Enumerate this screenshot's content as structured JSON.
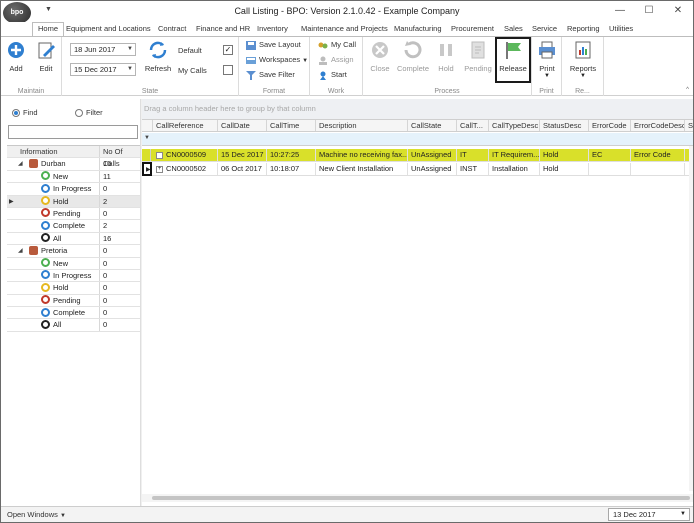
{
  "window": {
    "logo": "bpo",
    "title": "Call Listing - BPO: Version 2.1.0.42 - Example Company",
    "minimize": "—",
    "maximize": "☐",
    "close": "✕"
  },
  "tabs": [
    "Home",
    "Equipment and Locations",
    "Contract",
    "Finance and HR",
    "Inventory",
    "Maintenance and Projects",
    "Manufacturing",
    "Procurement",
    "Sales",
    "Service",
    "Reporting",
    "Utilities"
  ],
  "ribbon": {
    "maintain": {
      "label": "Maintain",
      "add": "Add",
      "edit": "Edit"
    },
    "state": {
      "label": "State",
      "date_from": "18 Jun 2017",
      "date_to": "15 Dec 2017",
      "refresh": "Refresh",
      "default": "Default",
      "my_calls": "My Calls",
      "default_checked": "✓"
    },
    "format": {
      "label": "Format",
      "save_layout": "Save Layout",
      "workspaces": "Workspaces",
      "save_filter": "Save Filter"
    },
    "work": {
      "label": "Work",
      "my_call": "My Call",
      "assign": "Assign",
      "start": "Start"
    },
    "process": {
      "label": "Process",
      "close": "Close",
      "complete": "Complete",
      "hold": "Hold",
      "pending": "Pending",
      "release": "Release"
    },
    "print": {
      "label": "Print",
      "print": "Print"
    },
    "reports": {
      "label": "Re...",
      "reports": "Reports"
    }
  },
  "left": {
    "find": "Find",
    "filter": "Filter",
    "col_info": "Information",
    "col_calls": "No Of Calls",
    "rows": [
      {
        "name": "Durban",
        "count": "16",
        "level": 0,
        "color": "#b85a3c"
      },
      {
        "name": "New",
        "count": "11",
        "level": 1,
        "color": "#4caf50"
      },
      {
        "name": "In Progress",
        "count": "0",
        "level": 1,
        "color": "#2f7fd0"
      },
      {
        "name": "Hold",
        "count": "2",
        "level": 1,
        "color": "#e6b820"
      },
      {
        "name": "Pending",
        "count": "0",
        "level": 1,
        "color": "#c0392b"
      },
      {
        "name": "Complete",
        "count": "2",
        "level": 1,
        "color": "#2f7fd0"
      },
      {
        "name": "All",
        "count": "16",
        "level": 1,
        "color": "#222222"
      },
      {
        "name": "Pretoria",
        "count": "0",
        "level": 0,
        "color": "#b85a3c"
      },
      {
        "name": "New",
        "count": "0",
        "level": 1,
        "color": "#4caf50"
      },
      {
        "name": "In Progress",
        "count": "0",
        "level": 1,
        "color": "#2f7fd0"
      },
      {
        "name": "Hold",
        "count": "0",
        "level": 1,
        "color": "#e6b820"
      },
      {
        "name": "Pending",
        "count": "0",
        "level": 1,
        "color": "#c0392b"
      },
      {
        "name": "Complete",
        "count": "0",
        "level": 1,
        "color": "#2f7fd0"
      },
      {
        "name": "All",
        "count": "0",
        "level": 1,
        "color": "#222222"
      }
    ]
  },
  "grid": {
    "group_hint": "Drag a column header here to group by that column",
    "columns": [
      "CallReference",
      "CallDate",
      "CallTime",
      "Description",
      "CallState",
      "CallT...",
      "CallTypeDesc",
      "StatusDesc",
      "ErrorCode",
      "ErrorCodeDesc",
      "Se"
    ],
    "rows": [
      [
        "CN0000509",
        "15 Dec 2017",
        "10:27:25",
        "Machine no receiving fax...",
        "UnAssigned",
        "IT",
        "IT Requirem...",
        "Hold",
        "EC",
        "Error Code",
        ""
      ],
      [
        "CN0000502",
        "06 Oct 2017",
        "10:18:07",
        "New Client Installation",
        "UnAssigned",
        "INST",
        "Installation",
        "Hold",
        "",
        "",
        ""
      ]
    ]
  },
  "status": {
    "open_windows": "Open Windows",
    "date": "13 Dec 2017"
  }
}
